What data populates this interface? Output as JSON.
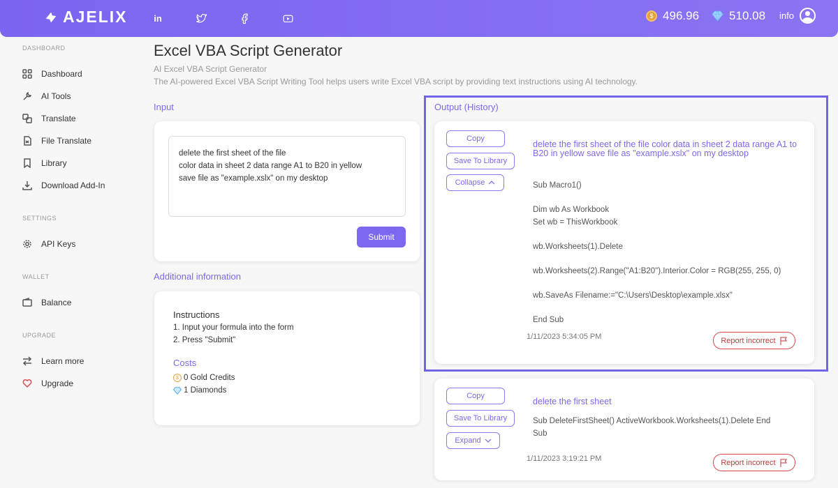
{
  "header": {
    "logo_text": "AJELIX",
    "socials": [
      "linkedin-icon",
      "twitter-icon",
      "facebook-icon",
      "youtube-icon"
    ],
    "gold_credits": "496.96",
    "diamonds": "510.08",
    "user_label": "info"
  },
  "sidebar": {
    "sections": [
      {
        "title": "DASHBOARD",
        "items": [
          "Dashboard",
          "AI Tools",
          "Translate",
          "File Translate",
          "Library",
          "Download Add-In"
        ]
      },
      {
        "title": "SETTINGS",
        "items": [
          "API Keys"
        ]
      },
      {
        "title": "WALLET",
        "items": [
          "Balance"
        ]
      },
      {
        "title": "UPGRADE",
        "items": [
          "Learn more",
          "Upgrade"
        ]
      }
    ]
  },
  "main": {
    "title": "Excel VBA Script Generator",
    "subtitle": "AI Excel VBA Script Generator",
    "description": "The AI-powered Excel VBA Script Writing Tool helps users write Excel VBA script by providing text instructions using AI technology.",
    "input_label": "Input",
    "input_value": "delete the first sheet of the file\ncolor data in sheet 2 data range A1 to B20 in yellow\nsave file as \"example.xslx\" on my desktop",
    "submit_label": "Submit",
    "additional_label": "Additional information",
    "instructions_title": "Instructions",
    "instructions": [
      "1. Input your formula into the form",
      "2. Press \"Submit\""
    ],
    "costs_title": "Costs",
    "cost_gold": "0 Gold Credits",
    "cost_diamonds": "1 Diamonds",
    "output_label": "Output (History)"
  },
  "history": [
    {
      "copy_label": "Copy",
      "save_label": "Save To Library",
      "toggle_label": "Collapse",
      "query": "delete the first sheet of the file color data in sheet 2 data range A1 to B20 in yellow save file as \"example.xslx\" on my desktop",
      "code": "Sub Macro1()\n\nDim wb As Workbook\nSet wb = ThisWorkbook\n\nwb.Worksheets(1).Delete\n\nwb.Worksheets(2).Range(\"A1:B20\").Interior.Color = RGB(255, 255, 0)\n\nwb.SaveAs Filename:=\"C:\\Users\\Desktop\\example.xlsx\"\n\nEnd Sub",
      "timestamp": "1/11/2023 5:34:05 PM",
      "report_label": "Report incorrect"
    },
    {
      "copy_label": "Copy",
      "save_label": "Save To Library",
      "toggle_label": "Expand",
      "query": "delete the first sheet",
      "code": "Sub DeleteFirstSheet() ActiveWorkbook.Worksheets(1).Delete End\nSub",
      "timestamp": "1/11/2023 3:19:21 PM",
      "report_label": "Report incorrect"
    }
  ],
  "colors": {
    "accent": "#7b68ee",
    "header": "#7b64f0",
    "report": "#d84a4a",
    "gold": "#e5a23c"
  }
}
